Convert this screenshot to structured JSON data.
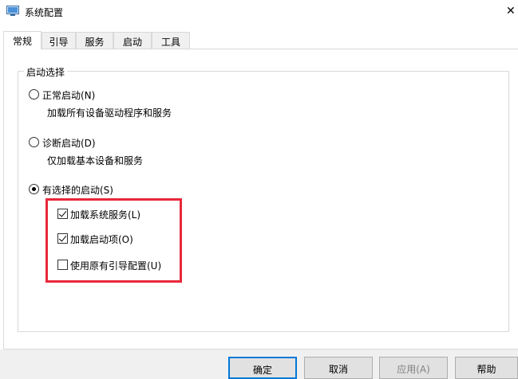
{
  "window": {
    "title": "系统配置",
    "close_glyph": "✕"
  },
  "tabs": [
    {
      "label": "常规",
      "active": true
    },
    {
      "label": "引导",
      "active": false
    },
    {
      "label": "服务",
      "active": false
    },
    {
      "label": "启动",
      "active": false
    },
    {
      "label": "工具",
      "active": false
    }
  ],
  "startup_group": {
    "legend": "启动选择",
    "normal": {
      "label": "正常启动(N)",
      "description": "加载所有设备驱动程序和服务",
      "selected": false
    },
    "diagnostic": {
      "label": "诊断启动(D)",
      "description": "仅加载基本设备和服务",
      "selected": false
    },
    "selective": {
      "label": "有选择的启动(S)",
      "selected": true,
      "options": [
        {
          "label": "加载系统服务(L)",
          "checked": true
        },
        {
          "label": "加载启动项(O)",
          "checked": true
        },
        {
          "label": "使用原有引导配置(U)",
          "checked": false
        }
      ]
    }
  },
  "highlight_color": "#e8283a",
  "buttons": {
    "ok": "确定",
    "cancel": "取消",
    "apply": "应用(A)",
    "help": "帮助"
  }
}
